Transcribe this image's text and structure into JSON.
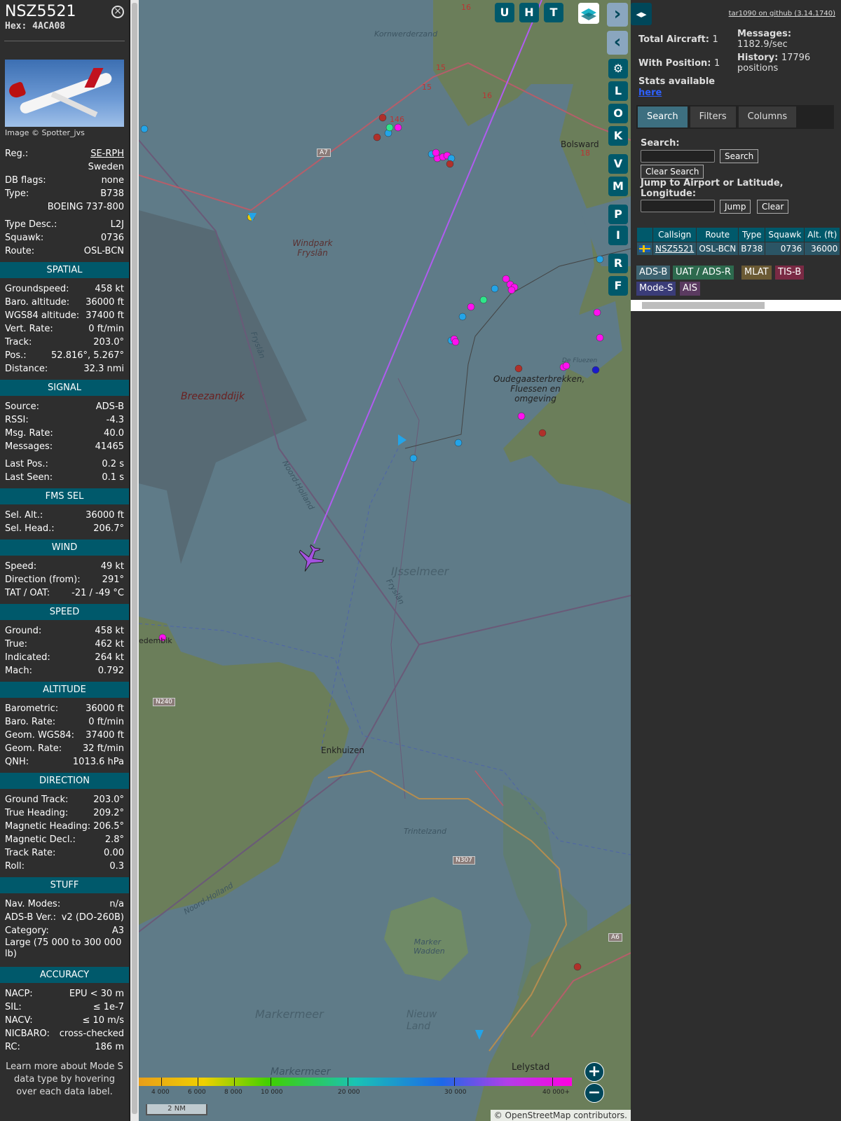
{
  "aircraft": {
    "callsign": "NSZ5521",
    "hex": "Hex: 4ACA08",
    "photo_credit": "Image © Spotter_jvs",
    "details": [
      {
        "label": "Reg.:",
        "value": "SE-RPH",
        "link": true
      },
      {
        "label": "",
        "value": "Sweden"
      },
      {
        "label": "DB flags:",
        "value": "none"
      },
      {
        "label": "Type:",
        "value": "B738"
      },
      {
        "label": "",
        "value": "BOEING 737-800"
      },
      {
        "label": "Type Desc.:",
        "value": "L2J",
        "gap_before": true
      },
      {
        "label": "Squawk:",
        "value": "0736"
      },
      {
        "label": "Route:",
        "value": "OSL-BCN"
      }
    ]
  },
  "sections": [
    {
      "title": "SPATIAL",
      "rows": [
        {
          "label": "Groundspeed:",
          "value": "458 kt"
        },
        {
          "label": "Baro. altitude:",
          "value": "36000 ft"
        },
        {
          "label": "WGS84 altitude:",
          "value": "37400 ft"
        },
        {
          "label": "Vert. Rate:",
          "value": "0 ft/min"
        },
        {
          "label": "Track:",
          "value": "203.0°"
        },
        {
          "label": "Pos.:",
          "value": "52.816°, 5.267°"
        },
        {
          "label": "Distance:",
          "value": "32.3 nmi"
        }
      ]
    },
    {
      "title": "SIGNAL",
      "rows": [
        {
          "label": "Source:",
          "value": "ADS-B"
        },
        {
          "label": "RSSI:",
          "value": "-4.3"
        },
        {
          "label": "Msg. Rate:",
          "value": "40.0"
        },
        {
          "label": "Messages:",
          "value": "41465"
        },
        {
          "label": "Last Pos.:",
          "value": "0.2 s",
          "gap_before": true
        },
        {
          "label": "Last Seen:",
          "value": "0.1 s"
        }
      ]
    },
    {
      "title": "FMS SEL",
      "rows": [
        {
          "label": "Sel. Alt.:",
          "value": "36000 ft"
        },
        {
          "label": "Sel. Head.:",
          "value": "206.7°"
        }
      ]
    },
    {
      "title": "WIND",
      "rows": [
        {
          "label": "Speed:",
          "value": "49 kt"
        },
        {
          "label": "Direction (from):",
          "value": "291°"
        },
        {
          "label": "TAT / OAT:",
          "value": "-21 / -49 °C"
        }
      ]
    },
    {
      "title": "SPEED",
      "rows": [
        {
          "label": "Ground:",
          "value": "458 kt"
        },
        {
          "label": "True:",
          "value": "462 kt"
        },
        {
          "label": "Indicated:",
          "value": "264 kt"
        },
        {
          "label": "Mach:",
          "value": "0.792"
        }
      ]
    },
    {
      "title": "ALTITUDE",
      "rows": [
        {
          "label": "Barometric:",
          "value": "36000 ft"
        },
        {
          "label": "Baro. Rate:",
          "value": "0 ft/min"
        },
        {
          "label": "Geom. WGS84:",
          "value": "37400 ft"
        },
        {
          "label": "Geom. Rate:",
          "value": "32 ft/min"
        },
        {
          "label": "QNH:",
          "value": "1013.6 hPa"
        }
      ]
    },
    {
      "title": "DIRECTION",
      "rows": [
        {
          "label": "Ground Track:",
          "value": "203.0°"
        },
        {
          "label": "True Heading:",
          "value": "209.2°"
        },
        {
          "label": "Magnetic Heading:",
          "value": "206.5°"
        },
        {
          "label": "Magnetic Decl.:",
          "value": "2.8°"
        },
        {
          "label": "Track Rate:",
          "value": "0.00"
        },
        {
          "label": "Roll:",
          "value": "0.3"
        }
      ]
    },
    {
      "title": "STUFF",
      "rows": [
        {
          "label": "Nav. Modes:",
          "value": "n/a"
        },
        {
          "label": "ADS-B Ver.:",
          "value": "v2 (DO-260B)"
        },
        {
          "label": "Category:",
          "value": "A3"
        },
        {
          "label": "Large (75 000 to 300 000 lb)",
          "value": ""
        }
      ]
    },
    {
      "title": "ACCURACY",
      "rows": [
        {
          "label": "NACP:",
          "value": "EPU < 30 m"
        },
        {
          "label": "SIL:",
          "value": "≤ 1e-7"
        },
        {
          "label": "NACV:",
          "value": "≤ 10 m/s"
        },
        {
          "label": "NICBARO:",
          "value": "cross-checked"
        },
        {
          "label": "RC:",
          "value": "186 m"
        }
      ]
    }
  ],
  "learn_more": "Learn more about Mode S data type by hovering over each data label.",
  "map": {
    "buttons_top": [
      "U",
      "H",
      "T"
    ],
    "buttons_side": [
      "L",
      "O",
      "K",
      "V",
      "M",
      "P",
      "I",
      "R",
      "F"
    ],
    "places": {
      "ijsselmeer": "IJsselmeer",
      "markermeer": "Markermeer",
      "markermeer2": "Markermeer",
      "nieuw_land": "Nieuw Land",
      "breezanddijk": "Breezanddijk",
      "kornwerderzand": "Kornwerderzand",
      "windpark": "Windpark Fryslân",
      "oudega": "Oudegaasterbrekken, Fluessen en omgeving",
      "trintelzand": "Trintelzand",
      "marker_wadden": "Marker Wadden",
      "fryslan1": "Fryslân",
      "fryslan2": "Fryslân",
      "noord_holland1": "Noord-Holland",
      "noord_holland2": "Noord-Holland",
      "de_fluezen": "De Fluezen"
    },
    "towns": {
      "bolsward": "Bolsward",
      "enkhuizen": "Enkhuizen",
      "lelystad": "Lelystad",
      "edembik": "edembik"
    },
    "shields": {
      "a7": "A7",
      "n240": "N240",
      "n307": "N307",
      "a6": "A6",
      "r15a": "15",
      "r15b": "15",
      "r16": "16",
      "r18": "18",
      "r146": "146",
      "r16b": "16"
    },
    "altitude_ticks": [
      "4 000",
      "6 000",
      "8 000",
      "10 000",
      "20 000",
      "30 000",
      "40 000+"
    ],
    "scale": "2 NM",
    "attribution_prefix": "© ",
    "attribution_link": "OpenStreetMap",
    "attribution_suffix": " contributors.",
    "zoom_in": "+",
    "zoom_out": "−"
  },
  "right": {
    "toggle": "◂▸",
    "github": "tar1090 on github (3.14.1740)",
    "total_aircraft_label": "Total Aircraft:",
    "total_aircraft": "1",
    "with_position_label": "With Position:",
    "with_position": "1",
    "messages_label": "Messages:",
    "messages": "1182.9/sec",
    "history_label": "History:",
    "history": "17796 positions",
    "stats_label": "Stats available",
    "stats_link": "here",
    "tabs": [
      "Search",
      "Filters",
      "Columns"
    ],
    "search_label": "Search:",
    "search_btn": "Search",
    "clear_search_btn": "Clear Search",
    "jump_label": "Jump to Airport or Latitude, Longitude:",
    "jump_btn": "Jump",
    "clear_btn": "Clear",
    "table_headers": [
      "",
      "Callsign",
      "Route",
      "Type",
      "Squawk",
      "Alt. (ft)"
    ],
    "table_row": {
      "flag": "SE",
      "callsign": "NSZ5521",
      "route": "OSL-BCN",
      "type": "B738",
      "squawk": "0736",
      "alt": "36000"
    },
    "legend": [
      "ADS-B",
      "UAT / ADS-R",
      "MLAT",
      "TIS-B",
      "Mode-S",
      "AIS"
    ]
  }
}
